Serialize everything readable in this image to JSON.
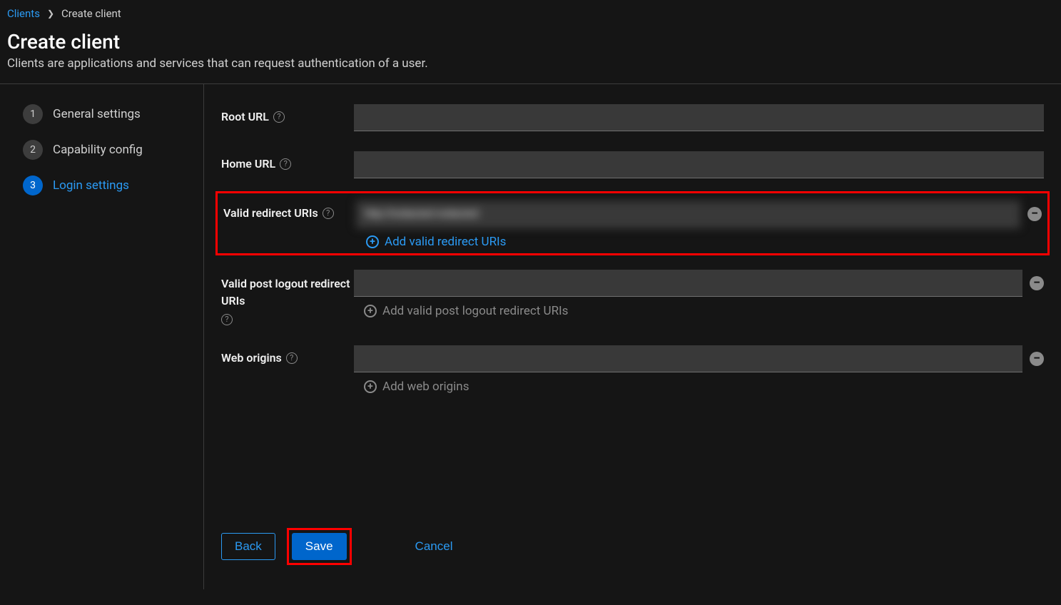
{
  "breadcrumb": {
    "root": "Clients",
    "current": "Create client"
  },
  "page": {
    "title": "Create client",
    "subtitle": "Clients are applications and services that can request authentication of a user."
  },
  "steps": [
    {
      "num": "1",
      "label": "General settings"
    },
    {
      "num": "2",
      "label": "Capability config"
    },
    {
      "num": "3",
      "label": "Login settings"
    }
  ],
  "form": {
    "rootUrl": {
      "label": "Root URL",
      "value": ""
    },
    "homeUrl": {
      "label": "Home URL",
      "value": ""
    },
    "validRedirect": {
      "label": "Valid redirect URIs",
      "value": "http://redacted-redacted",
      "addLabel": "Add valid redirect URIs"
    },
    "postLogout": {
      "label": "Valid post logout redirect URIs",
      "value": "",
      "addLabel": "Add valid post logout redirect URIs"
    },
    "webOrigins": {
      "label": "Web origins",
      "value": "",
      "addLabel": "Add web origins"
    }
  },
  "buttons": {
    "back": "Back",
    "save": "Save",
    "cancel": "Cancel"
  }
}
